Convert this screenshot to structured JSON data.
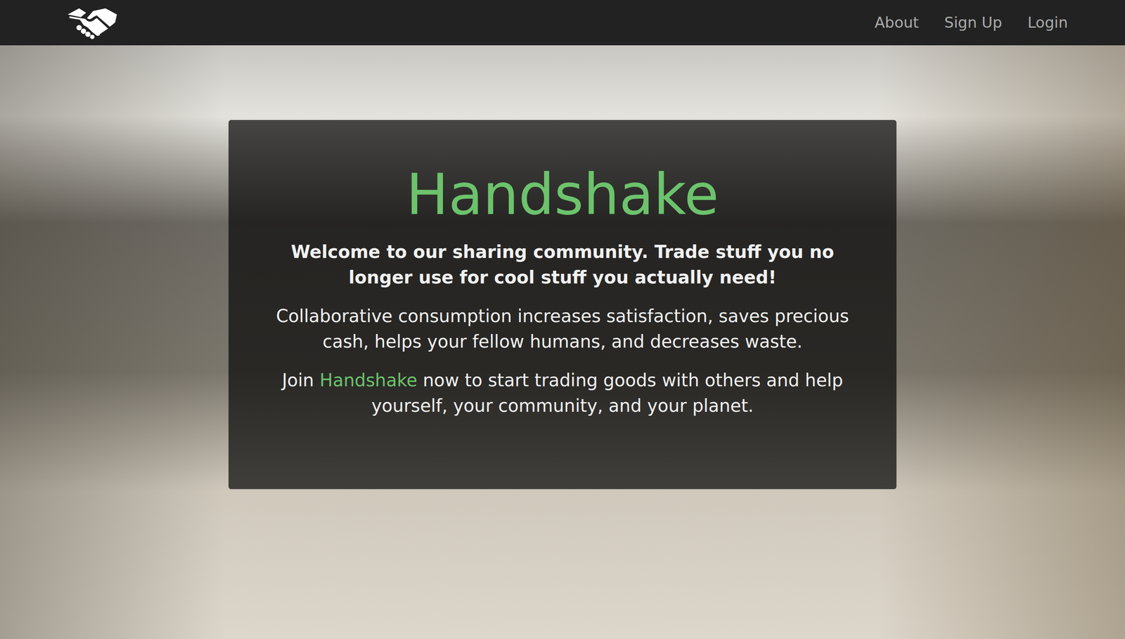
{
  "navbar": {
    "links": [
      "About",
      "Sign Up",
      "Login"
    ]
  },
  "hero": {
    "title": "Handshake",
    "paragraphs": [
      {
        "kind": "lead",
        "segments": [
          {
            "text": "Welcome to our sharing community. Trade stuff you no longer use for cool stuff you actually need!",
            "highlight": false
          }
        ]
      },
      {
        "kind": "body",
        "segments": [
          {
            "text": "Collaborative consumption increases satisfaction, saves precious cash, helps your fellow humans, and decreases waste.",
            "highlight": false
          }
        ]
      },
      {
        "kind": "body",
        "segments": [
          {
            "text": "Join ",
            "highlight": false
          },
          {
            "text": "Handshake",
            "highlight": true
          },
          {
            "text": " now to start trading goods with others and help yourself, your community, and your planet.",
            "highlight": false
          }
        ]
      }
    ]
  }
}
